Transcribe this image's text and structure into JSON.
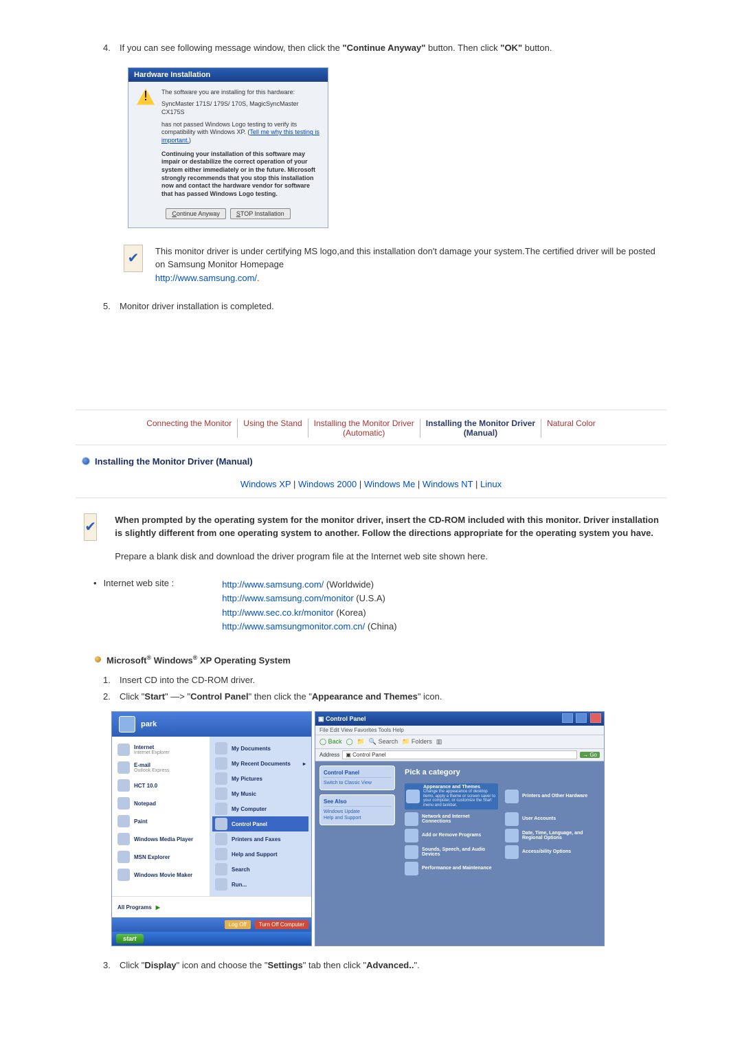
{
  "step4": {
    "num": "4.",
    "text_before": "If you can see following message window, then click the ",
    "btn1": "\"Continue Anyway\"",
    "text_mid": " button. Then click ",
    "btn2": "\"OK\"",
    "text_after": " button."
  },
  "dialog": {
    "title": "Hardware Installation",
    "l1": "The software you are installing for this hardware:",
    "l2": "SyncMaster 171S/ 179S/ 170S, MagicSyncMaster CX175S",
    "l3a": "has not passed Windows Logo testing to verify its compatibility with Windows XP. (",
    "l3link": "Tell me why this testing is important.",
    "l3b": ")",
    "warn": "Continuing your installation of this software may impair or destabilize the correct operation of your system either immediately or in the future. Microsoft strongly recommends that you stop this installation now and contact the hardware vendor for software that has passed Windows Logo testing.",
    "btn_continue_u": "C",
    "btn_continue_rest": "ontinue Anyway",
    "btn_stop_u": "S",
    "btn_stop_rest": "TOP Installation"
  },
  "note": {
    "text": "This monitor driver is under certifying MS logo,and this installation don't damage your system.The certified driver will be posted on Samsung Monitor Homepage",
    "link": "http://www.samsung.com/",
    "period": "."
  },
  "step5": {
    "num": "5.",
    "text": "Monitor driver installation is completed."
  },
  "tabs": {
    "t1": "Connecting  the Monitor",
    "t2": "Using the Stand",
    "t3a": "Installing the Monitor Driver",
    "t3b": "(Automatic)",
    "t4a": "Installing the Monitor Driver",
    "t4b": "(Manual)",
    "t5": "Natural Color"
  },
  "section_title": "Installing the Monitor Driver (Manual)",
  "oslinks": {
    "xp": "Windows XP",
    "w2k": "Windows 2000",
    "me": "Windows Me",
    "nt": "Windows NT",
    "linux": "Linux",
    "sep": " | "
  },
  "cd": {
    "bold": "When prompted by the operating system for the monitor driver, insert the CD-ROM included with this monitor. Driver installation is slightly different from one operating system to another. Follow the directions appropriate for the operating system you have.",
    "prep": "Prepare a blank disk and download the driver program file at the Internet web site shown here."
  },
  "sites": {
    "label": "Internet web site :",
    "s1": "http://www.samsung.com/",
    "s1t": " (Worldwide)",
    "s2": "http://www.samsung.com/monitor",
    "s2t": " (U.S.A)",
    "s3": "http://www.sec.co.kr/monitor",
    "s3t": " (Korea)",
    "s4": "http://www.samsungmonitor.com.cn/",
    "s4t": " (China)"
  },
  "subsection": {
    "pre": "Microsoft",
    "reg": "®",
    "mid": " Windows",
    "suf": " XP Operating System"
  },
  "xp1": {
    "num": "1.",
    "text": "Insert CD into the CD-ROM driver."
  },
  "xp2": {
    "num": "2.",
    "a": "Click \"",
    "b": "Start",
    "c": "\" —> \"",
    "d": "Control Panel",
    "e": "\" then click the \"",
    "f": "Appearance and Themes",
    "g": "\" icon."
  },
  "startmenu": {
    "user": "park",
    "left": [
      {
        "t": "Internet",
        "s": "Internet Explorer"
      },
      {
        "t": "E-mail",
        "s": "Outlook Express"
      },
      {
        "t": "HCT 10.0",
        "s": ""
      },
      {
        "t": "Notepad",
        "s": ""
      },
      {
        "t": "Paint",
        "s": ""
      },
      {
        "t": "Windows Media Player",
        "s": ""
      },
      {
        "t": "MSN Explorer",
        "s": ""
      },
      {
        "t": "Windows Movie Maker",
        "s": ""
      }
    ],
    "all": "All Programs",
    "right": [
      "My Documents",
      "My Recent Documents",
      "My Pictures",
      "My Music",
      "My Computer",
      "Control Panel",
      "Printers and Faxes",
      "Help and Support",
      "Search",
      "Run..."
    ],
    "right_hl_index": 5,
    "logoff": "Log Off",
    "turnoff": "Turn Off Computer",
    "start": "start"
  },
  "cp": {
    "title": "Control Panel",
    "menu": "File    Edit    View    Favorites    Tools    Help",
    "back": "Back",
    "search": "Search",
    "folders": "Folders",
    "addr_label": "Address",
    "addr_value": "Control Panel",
    "go": "Go",
    "side1_h": "Control Panel",
    "side1_i": "Switch to Classic View",
    "side2_h": "See Also",
    "side2_a": "Windows Update",
    "side2_b": "Help and Support",
    "pick": "Pick a category",
    "cats": [
      "Appearance and Themes",
      "Printers and Other Hardware",
      "Network and Internet Connections",
      "User Accounts",
      "Add or Remove Programs",
      "Date, Time, Language, and Regional Options",
      "Sounds, Speech, and Audio Devices",
      "Accessibility Options",
      "Performance and Maintenance"
    ],
    "cat_hint": "Change the appearance of desktop items, apply a theme or screen saver to your computer, or customize the Start menu and taskbar."
  },
  "xp3": {
    "num": "3.",
    "a": "Click \"",
    "b": "Display",
    "c": "\" icon and choose the \"",
    "d": "Settings",
    "e": "\" tab then click \"",
    "f": "Advanced..",
    "g": "\"."
  }
}
